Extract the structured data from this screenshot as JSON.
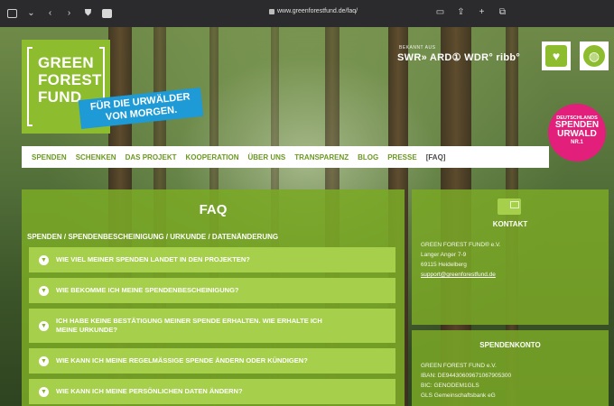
{
  "browser": {
    "url": "www.greenforestfund.de/faq/"
  },
  "logo": {
    "lines": [
      "GREEN",
      "FOREST",
      "FUND"
    ],
    "tagline_1": "FÜR DIE URWÄLDER",
    "tagline_2": "VON MORGEN."
  },
  "media": {
    "caption": "BEKANNT AUS",
    "brands": "SWR» ARD① WDR° ribb°"
  },
  "badge": {
    "line1": "DEUTSCHLANDS",
    "line2": "SPENDEN",
    "line3": "URWALD",
    "line4": "NR.1"
  },
  "nav": {
    "items": [
      {
        "label": "SPENDEN",
        "active": false
      },
      {
        "label": "SCHENKEN",
        "active": false
      },
      {
        "label": "DAS PROJEKT",
        "active": false
      },
      {
        "label": "KOOPERATION",
        "active": false
      },
      {
        "label": "ÜBER UNS",
        "active": false
      },
      {
        "label": "TRANSPARENZ",
        "active": false
      },
      {
        "label": "BLOG",
        "active": false
      },
      {
        "label": "PRESSE",
        "active": false
      },
      {
        "label": "[FAQ]",
        "active": true
      }
    ]
  },
  "faq": {
    "title": "FAQ",
    "section": "SPENDEN / SPENDENBESCHEINIGUNG / URKUNDE / DATENÄNDERUNG",
    "questions": [
      "WIE VIEL MEINER SPENDEN LANDET IN DEN PROJEKTEN?",
      "WIE BEKOMME ICH MEINE SPENDENBESCHEINIGUNG?",
      "ICH HABE KEINE BESTÄTIGUNG MEINER SPENDE ERHALTEN. WIE ERHALTE ICH MEINE URKUNDE?",
      "WIE KANN ICH MEINE REGELMÄSSIGE SPENDE ÄNDERN ODER KÜNDIGEN?",
      "WIE KANN ICH MEINE PERSÖNLICHEN DATEN ÄNDERN?"
    ]
  },
  "contact": {
    "title": "KONTAKT",
    "org": "GREEN FOREST FUND® e.V.",
    "street": "Langer Anger 7-9",
    "city": "69115 Heidelberg",
    "email": "support@greenforestfund.de"
  },
  "account": {
    "title": "SPENDENKONTO",
    "org": "GREEN FOREST FUND e.V.",
    "iban": "IBAN: DE94430609671067905300",
    "bic": "BIC: GENODEM1GLS",
    "bank": "GLS Gemeinschaftsbank eG"
  }
}
